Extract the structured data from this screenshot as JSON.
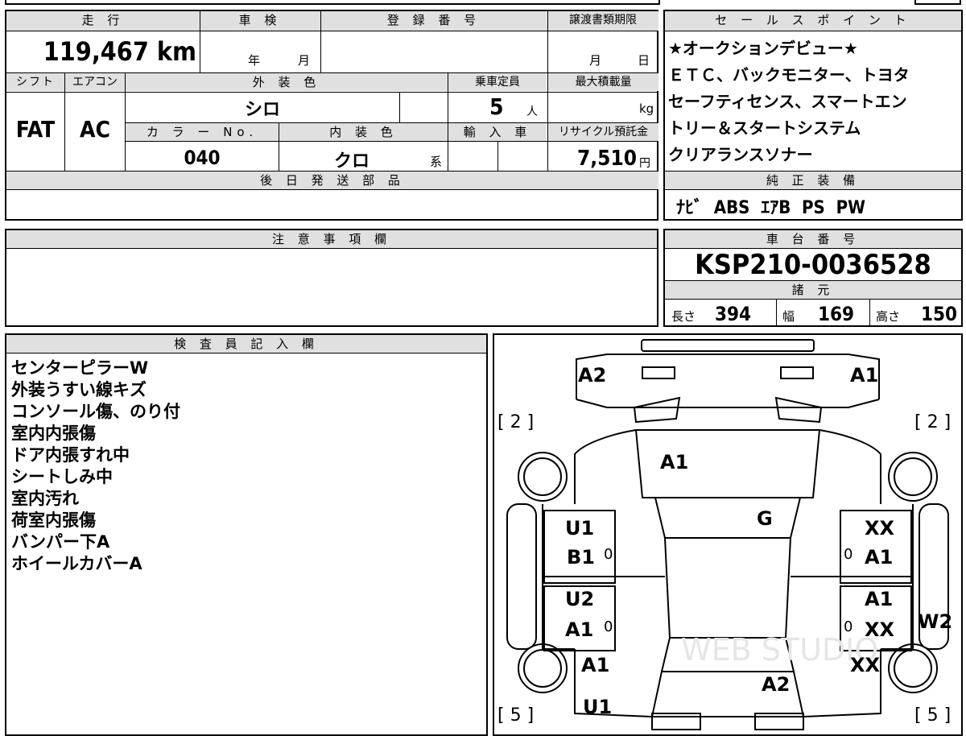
{
  "mileage": {
    "label": "走 行",
    "value": "119,467 km"
  },
  "inspection": {
    "label": "車 検",
    "year": "年",
    "month": "月"
  },
  "registration": {
    "label": "登 録 番 号",
    "value": ""
  },
  "transfer_deadline": {
    "label": "譲渡書類期限",
    "month": "月",
    "day": "日"
  },
  "shift": {
    "label": "シフト",
    "value": "FAT"
  },
  "aircon": {
    "label": "エアコン",
    "value": "AC"
  },
  "exterior_color": {
    "label": "外 装 色",
    "value": "シロ"
  },
  "capacity": {
    "label": "乗車定員",
    "value": "5",
    "unit": "人"
  },
  "max_load": {
    "label": "最大積載量",
    "unit": "kg"
  },
  "color_no": {
    "label": "カ ラ ー No.",
    "value": "040"
  },
  "interior_color": {
    "label": "内 装 色",
    "value": "クロ",
    "suffix": "系"
  },
  "import": {
    "label": "輸 入 車"
  },
  "recycle": {
    "label": "リサイクル預託金",
    "value": "7,510",
    "unit": "円"
  },
  "later_parts": {
    "label": "後 日 発 送 部 品"
  },
  "sales_points": {
    "label": "セ ー ル ス ポ イ ン ト",
    "lines": [
      "★オークションデビュー★",
      "ＥＴＣ、バックモニター、トヨタ",
      "セーフティセンス、スマートエン",
      "トリー＆スタートシステム",
      "クリアランスソナー"
    ]
  },
  "genuine_equipment": {
    "label": "純 正 装 備",
    "value": "ﾅﾋﾞ  ABS  ｴｱB  PS  PW"
  },
  "notes": {
    "label": "注 意 事 項 欄"
  },
  "chassis": {
    "label": "車 台 番 号",
    "value": "KSP210-0036528"
  },
  "specs": {
    "label": "諸 元",
    "length_label": "長さ",
    "length": "394",
    "width_label": "幅",
    "width": "169",
    "height_label": "高さ",
    "height": "150"
  },
  "inspector": {
    "label": "検 査 員 記 入 欄",
    "lines": [
      "センターピラーW",
      "外装うすい線キズ",
      "コンソール傷、のり付",
      "室内内張傷",
      "ドア内張すれ中",
      "シートしみ中",
      "室内汚れ",
      "荷室内張傷",
      "バンパー下A",
      "ホイールカバーA"
    ]
  },
  "diagram": {
    "tread_front_left": "[ 2 ]",
    "tread_front_right": "[ 2 ]",
    "tread_rear_left": "[ 5 ]",
    "tread_rear_right": "[ 5 ]",
    "marks": {
      "front_left": "A2",
      "front_right": "A1",
      "hood": "A1",
      "windshield": "G",
      "left_front_door_1": "U1",
      "left_front_door_2": "B1",
      "left_rear_door_1": "U2",
      "left_rear_door_2": "A1",
      "right_front_door_1": "XX",
      "right_front_door_2": "A1",
      "right_rear_door_1": "A1",
      "right_rear_door_2": "XX",
      "right_fender": "W2",
      "left_rear_fender": "A1",
      "right_rear_fender": "XX",
      "rear_bumper_left": "U1",
      "rear": "A2",
      "zero_1": "0",
      "zero_2": "0",
      "zero_3": "0",
      "zero_4": "0"
    },
    "watermark": "WEB STUDIO"
  }
}
